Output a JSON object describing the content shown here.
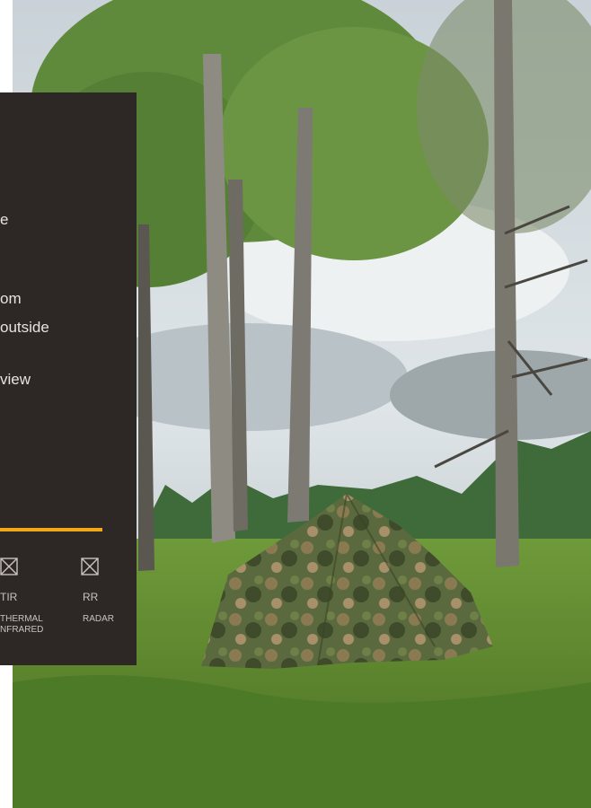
{
  "panel": {
    "body_lines": [
      "e",
      "om",
      "outside",
      "view"
    ],
    "accent_color": "#f0a818",
    "background_color": "#2d2726",
    "features": [
      {
        "icon": "crossed-box-icon",
        "code": "TIR",
        "desc_lines": [
          "THERMAL",
          "NFRARED"
        ]
      },
      {
        "icon": "crossed-box-icon",
        "code": "RR",
        "desc_lines": [
          "RADAR"
        ]
      }
    ]
  }
}
